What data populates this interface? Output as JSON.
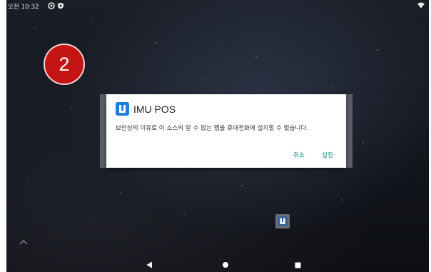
{
  "status_bar": {
    "time": "오전 10:32",
    "icons": [
      "sync-icon",
      "shield-icon",
      "wifi-icon"
    ]
  },
  "step_badge": {
    "number": "2"
  },
  "dialog": {
    "app_name": "IMU POS",
    "app_icon": "imu-app-icon",
    "message": "보안상의 이유로 이 소스의 알 수 없는 앱을 휴대전화에 설치할 수 없습니다.",
    "cancel_label": "취소",
    "settings_label": "설정"
  },
  "home": {
    "app_icon": "imu-app-icon"
  },
  "nav_bar": {
    "icons": [
      "back-icon",
      "home-icon",
      "recent-apps-icon"
    ]
  },
  "colors": {
    "badge": "#c41414",
    "accent_button": "#0f8a7e",
    "app_icon": "#1b7fe0"
  }
}
